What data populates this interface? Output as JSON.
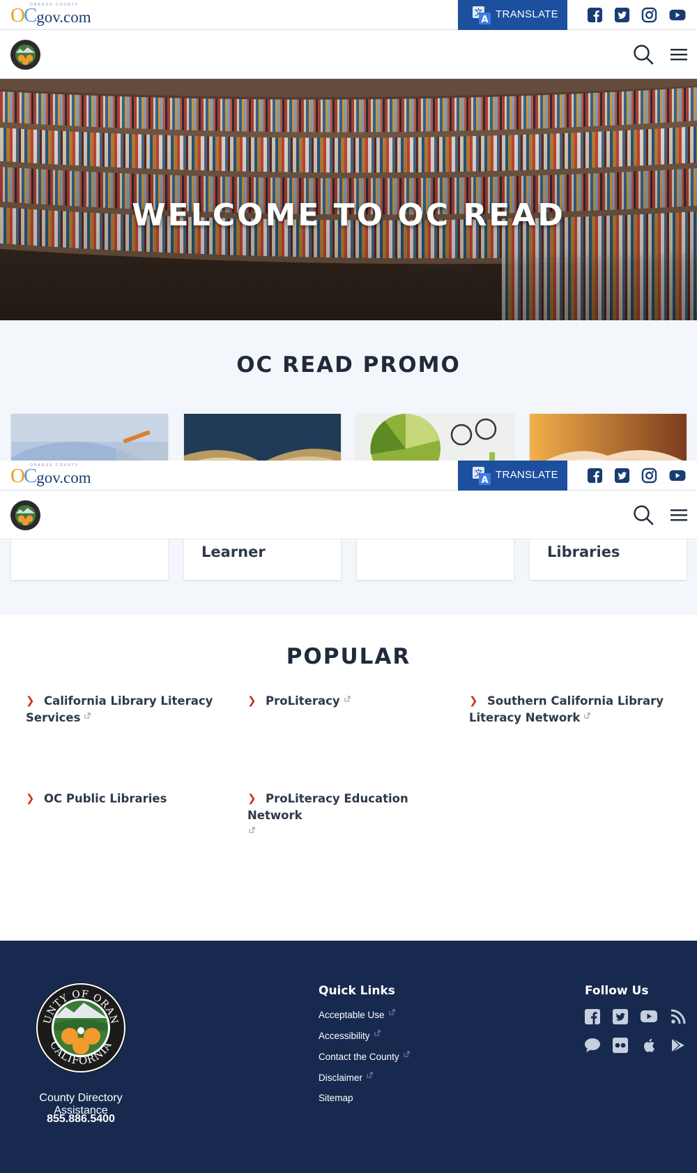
{
  "header": {
    "logo_oc_o": "O",
    "logo_oc_c": "C",
    "logo_gov": "gov.com",
    "logo_tagline": "ORANGE COUNTY",
    "translate_label": "TRANSLATE",
    "social": [
      "facebook-icon",
      "twitter-icon",
      "instagram-icon",
      "youtube-icon"
    ],
    "brand_color": "#1c4f9e"
  },
  "nav": {
    "seal_text_top": "COUNTY OF ORANGE",
    "seal_text_bottom": "CALIFORNIA",
    "search_icon": "search-icon",
    "menu_icon": "hamburger-menu-icon"
  },
  "hero": {
    "title": "WELCOME TO OC READ"
  },
  "promo": {
    "title": "OC READ PROMO",
    "cards": [
      {
        "label": ""
      },
      {
        "label": "Learner"
      },
      {
        "label": ""
      },
      {
        "label": "Libraries"
      }
    ]
  },
  "popular": {
    "title": "POPULAR",
    "links": [
      {
        "label": "California Library Literacy Services",
        "external": true
      },
      {
        "label": "ProLiteracy",
        "external": true
      },
      {
        "label": "Southern California Library Literacy Network",
        "external": true
      },
      {
        "label": "OC Public Libraries",
        "external": false
      },
      {
        "label": "ProLiteracy Education Network",
        "external": true
      }
    ]
  },
  "footer": {
    "directory_label": "County Directory Assistance",
    "directory_phone": "855.886.5400",
    "quick_links_title": "Quick Links",
    "quick_links": [
      {
        "label": "Acceptable Use",
        "external": true
      },
      {
        "label": "Accessibility",
        "external": true
      },
      {
        "label": "Contact the County",
        "external": true
      },
      {
        "label": "Disclaimer",
        "external": true
      },
      {
        "label": "Sitemap",
        "external": false
      }
    ],
    "follow_title": "Follow Us",
    "follow_icons": [
      "facebook-icon",
      "twitter-icon",
      "youtube-icon",
      "rss-icon",
      "chat-icon",
      "flickr-icon",
      "apple-icon",
      "google-play-icon"
    ],
    "background": "#17294f"
  }
}
